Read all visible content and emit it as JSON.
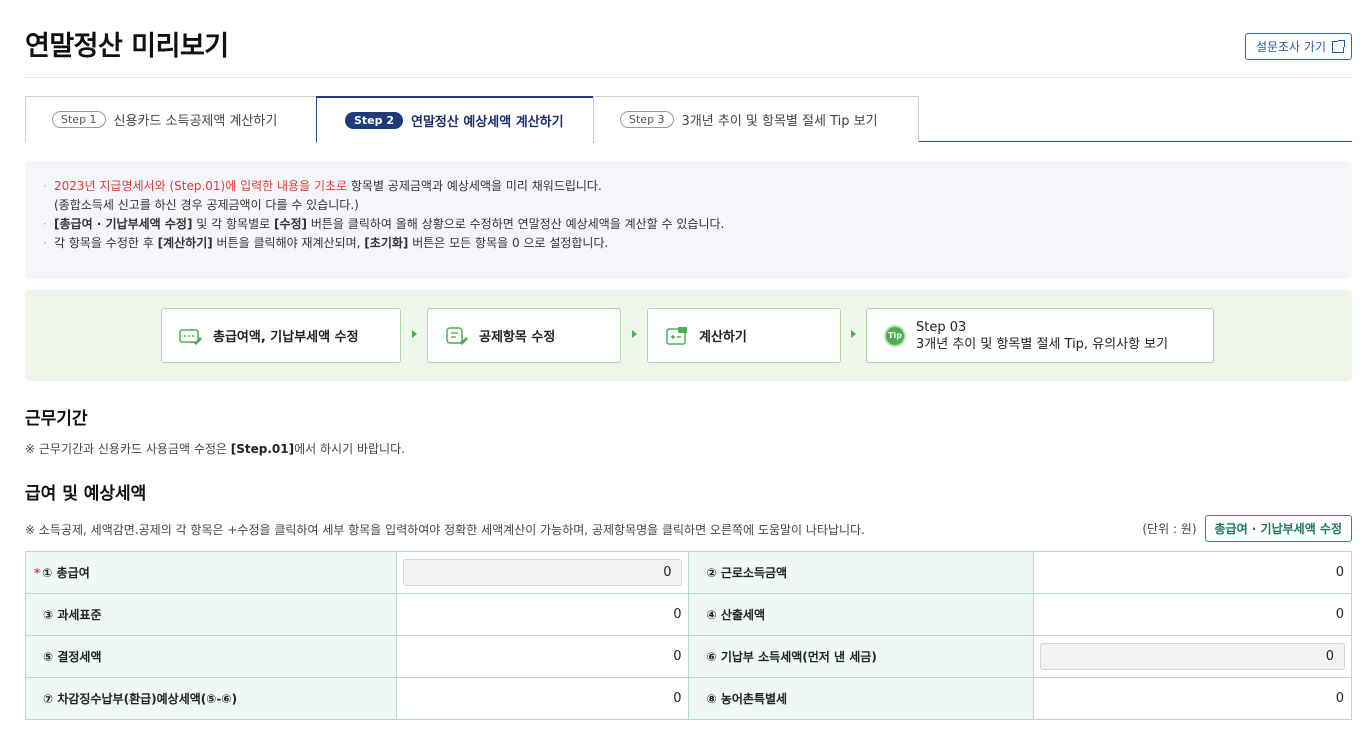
{
  "header": {
    "title": "연말정산 미리보기",
    "survey_label": "설문조사 가기"
  },
  "tabs": [
    {
      "step": "Step 1",
      "label": "신용카드 소득공제액 계산하기",
      "active": false
    },
    {
      "step": "Step 2",
      "label": "연말정산 예상세액 계산하기",
      "active": true
    },
    {
      "step": "Step 3",
      "label": "3개년 추이 및 항목별 절세 Tip 보기",
      "active": false
    }
  ],
  "notice": {
    "line1_red": "2023년 지급명세서와 (Step.01)에 입력한 내용을 기초로",
    "line1_rest": " 항목별 공제금액과 예상세액을 미리 채워드립니다.",
    "line1_sub": "(종합소득세 신고를 하신 경우 공제금액이 다를 수 있습니다.)",
    "line2_b1": "[총급여 · 기납부세액 수정]",
    "line2_t1": " 및 각 항목별로 ",
    "line2_b2": "[수정]",
    "line2_t2": " 버튼을 클릭하여 올해 상황으로 수정하면 연말정산 예상세액을 계산할 수 있습니다.",
    "line3_t1": "각 항목을 수정한 후 ",
    "line3_b1": "[계산하기]",
    "line3_t2": " 버튼을 클릭해야 재계산되며, ",
    "line3_b2": "[초기화]",
    "line3_t3": " 버튼은 모든 항목을 0 으로 설정합니다."
  },
  "flow": {
    "box1": "총급여액, 기납부세액 수정",
    "box2": "공제항목 수정",
    "box3": "계산하기",
    "box4_line1": "Step 03",
    "box4_line2": "3개년 추이 및 항목별 절세 Tip, 유의사항 보기",
    "tip_icon_text": "Tip"
  },
  "work_period": {
    "title": "근무기간",
    "note_pre": "※ 근무기간과 신용카드 사용금액 수정은 ",
    "note_bold": "[Step.01]",
    "note_post": "에서 하시기 바랍니다."
  },
  "salary": {
    "title": "급여 및 예상세액",
    "note": "※ 소득공제, 세액감면.공제의 각 항목은 +수정을 클릭하여 세부 항목을 입력하여야 정확한 세액계산이 가능하며, 공제항목명을 클릭하면 오른쪽에 도움말이 나타납니다.",
    "unit": "(단위 : 원)",
    "edit_button": "총급여 · 기납부세액 수정",
    "required_mark": "*",
    "rows": [
      {
        "l1": "① 총급여",
        "v1": "0",
        "l2": "② 근로소득금액",
        "v2": "0"
      },
      {
        "l1": "③ 과세표준",
        "v1": "0",
        "l2": "④ 산출세액",
        "v2": "0"
      },
      {
        "l1": "⑤ 결정세액",
        "v1": "0",
        "l2": "⑥ 기납부 소득세액(먼저 낸 세금)",
        "v2": "0"
      },
      {
        "l1": "⑦ 차감징수납부(환급)예상세액(⑤-⑥)",
        "v1": "0",
        "l2": "⑧ 농어촌특별세",
        "v2": "0"
      }
    ]
  }
}
